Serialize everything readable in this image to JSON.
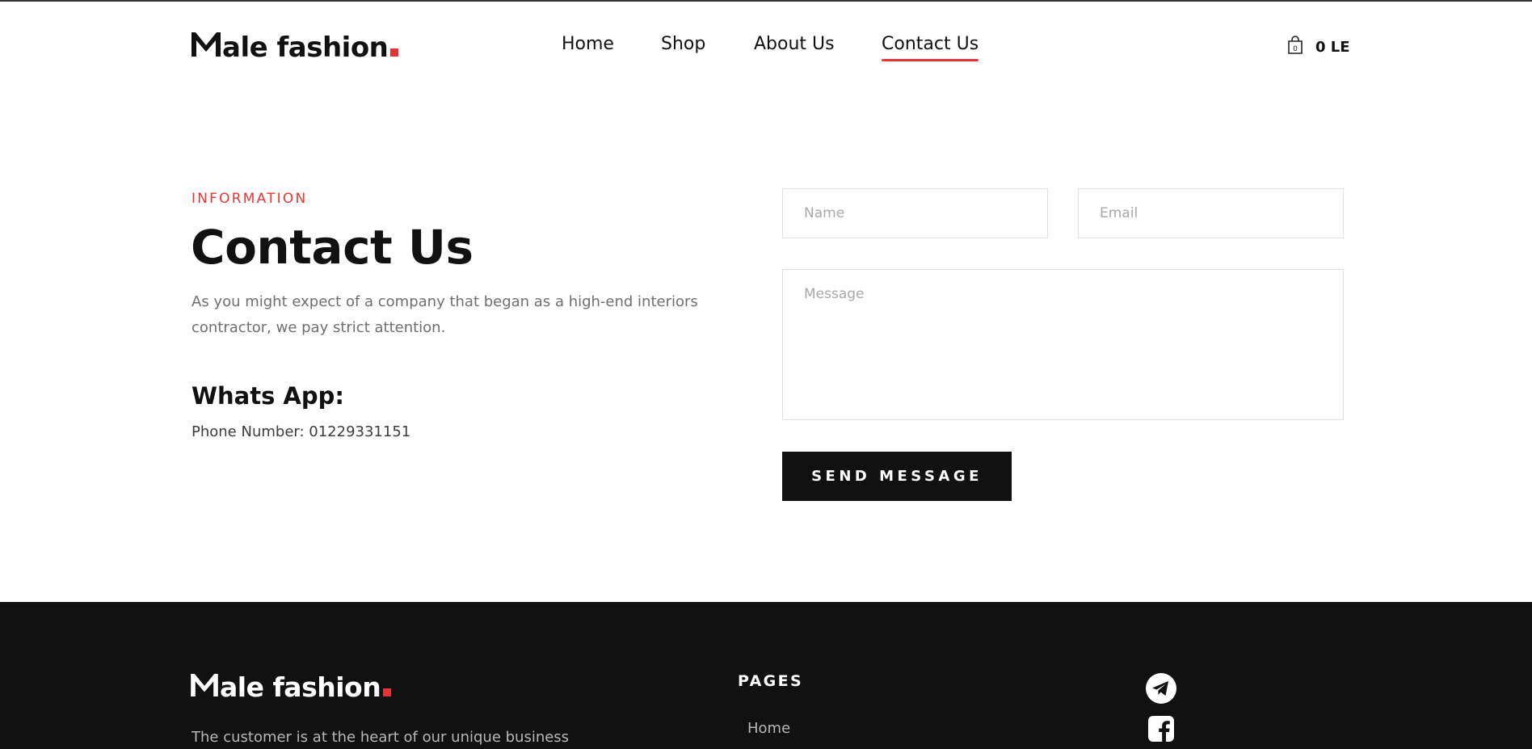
{
  "brand": {
    "name_rest": "ale fashion",
    "accent_color": "#e53637"
  },
  "nav": {
    "items": [
      {
        "label": "Home",
        "active": false
      },
      {
        "label": "Shop",
        "active": false
      },
      {
        "label": "About Us",
        "active": false
      },
      {
        "label": "Contact Us",
        "active": true
      }
    ]
  },
  "cart": {
    "icon": "shopping-bag-icon",
    "count": "0",
    "total": "0 LE"
  },
  "info": {
    "eyebrow": "INFORMATION",
    "title": "Contact Us",
    "description": "As you might expect of a company that began as a high-end interiors contractor, we pay strict attention.",
    "whatsapp_title": "Whats App:",
    "phone": "Phone Number: 01229331151"
  },
  "form": {
    "name_placeholder": "Name",
    "email_placeholder": "Email",
    "message_placeholder": "Message",
    "name_value": "",
    "email_value": "",
    "message_value": "",
    "submit_label": "SEND MESSAGE"
  },
  "footer": {
    "description": "The customer is at the heart of our unique business",
    "pages_title": "PAGES",
    "pages_links": [
      "Home"
    ],
    "social": [
      "telegram-icon",
      "facebook-icon"
    ],
    "background_color": "#111111"
  }
}
